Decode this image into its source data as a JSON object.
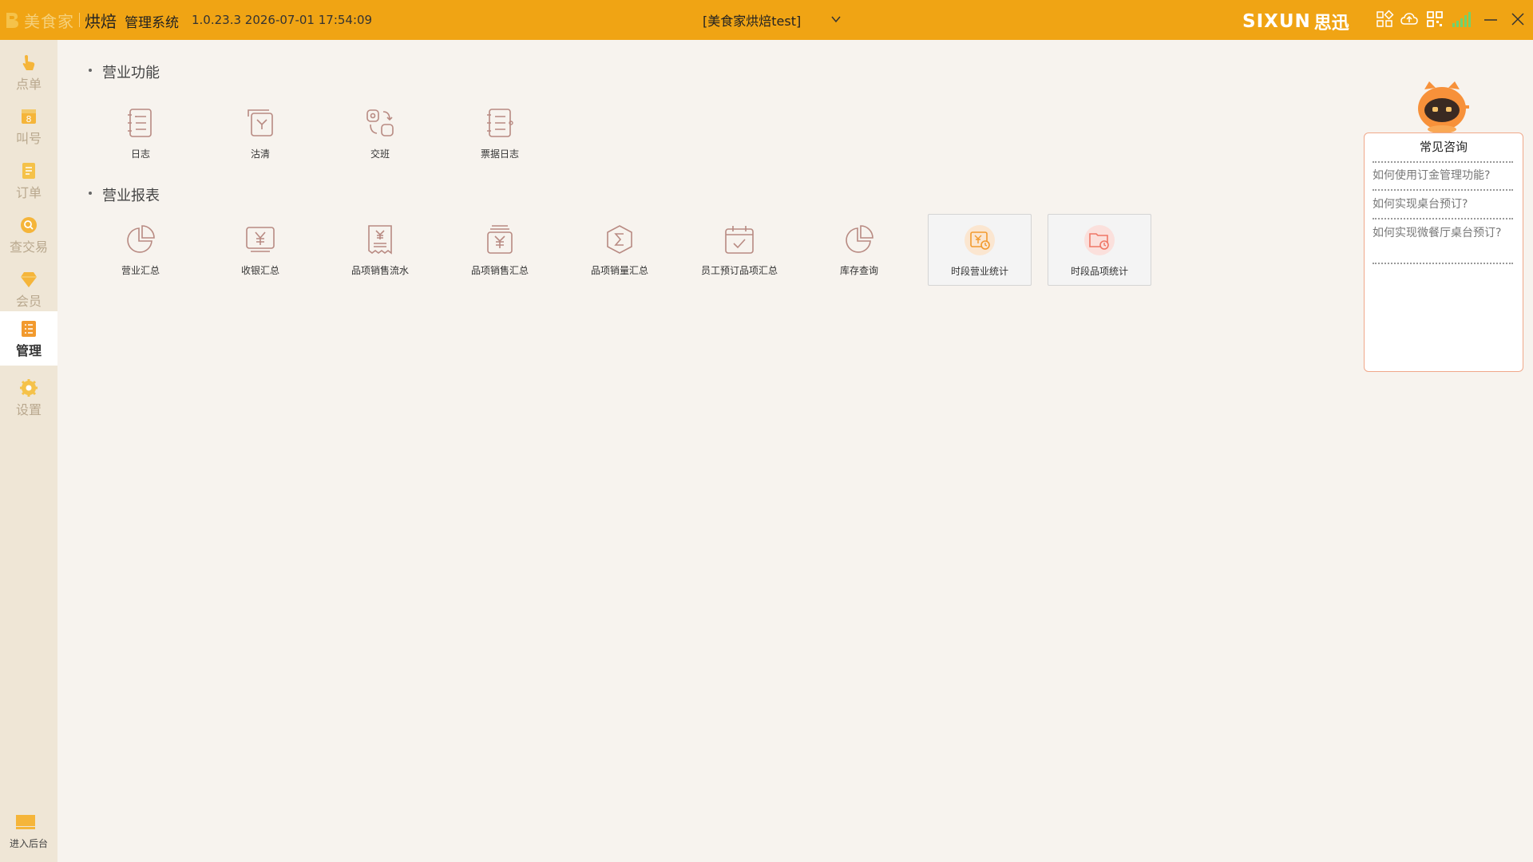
{
  "app": {
    "brand_name": "美食家",
    "brand_sub": "烘焙",
    "system_name": "管理系统",
    "version_datetime": "1.0.23.3 2026-07-01 17:54:09",
    "store_name": "[美食家烘焙test]",
    "vendor_latin": "SIXUN",
    "vendor_cn": "思迅"
  },
  "topbar_icons": [
    "apps-grid-icon",
    "cloud-icon",
    "qr-code-icon",
    "signal-bars-icon",
    "minimize-icon",
    "close-icon"
  ],
  "sidebar": {
    "items": [
      {
        "label": "点单",
        "icon": "hand-pointer-icon",
        "active": false
      },
      {
        "label": "叫号",
        "icon": "number-ticket-icon",
        "active": false
      },
      {
        "label": "订单",
        "icon": "document-icon",
        "active": false
      },
      {
        "label": "查交易",
        "icon": "search-icon",
        "active": false
      },
      {
        "label": "会员",
        "icon": "diamond-icon",
        "active": false
      },
      {
        "label": "管理",
        "icon": "list-icon",
        "active": true
      },
      {
        "label": "设置",
        "icon": "gear-icon",
        "active": false
      }
    ],
    "backend_label": "进入后台"
  },
  "main": {
    "business_functions": {
      "title": "营业功能",
      "items": [
        {
          "label": "日志",
          "icon": "notebook-icon"
        },
        {
          "label": "沽清",
          "icon": "sold-out-icon"
        },
        {
          "label": "交班",
          "icon": "shift-handover-icon"
        },
        {
          "label": "票据日志",
          "icon": "receipt-log-icon"
        }
      ]
    },
    "business_reports": {
      "title": "营业报表",
      "items": [
        {
          "label": "营业汇总",
          "icon": "pie-chart-icon"
        },
        {
          "label": "收银汇总",
          "icon": "yen-icon"
        },
        {
          "label": "品项销售流水",
          "icon": "yen-receipt-icon"
        },
        {
          "label": "品项销售汇总",
          "icon": "yen-stack-icon"
        },
        {
          "label": "品项销量汇总",
          "icon": "sigma-icon"
        },
        {
          "label": "员工预订品项汇总",
          "icon": "calendar-check-icon"
        },
        {
          "label": "库存查询",
          "icon": "pie-chart-icon"
        },
        {
          "label": "时段营业统计",
          "icon": "period-revenue-icon"
        },
        {
          "label": "时段品项统计",
          "icon": "period-item-icon"
        }
      ]
    }
  },
  "faq": {
    "title": "常见咨询",
    "questions": [
      "如何使用订金管理功能?",
      "如何实现桌台预订?",
      "如何实现微餐厅桌台预订?"
    ]
  },
  "colors": {
    "topbar": "#f0a414",
    "sidebar": "#efe6d6",
    "main_bg": "#f7f3ee",
    "icon_stroke": "#b88a82",
    "accent_orange": "#f29a2e",
    "faq_border": "#f0a88a"
  }
}
